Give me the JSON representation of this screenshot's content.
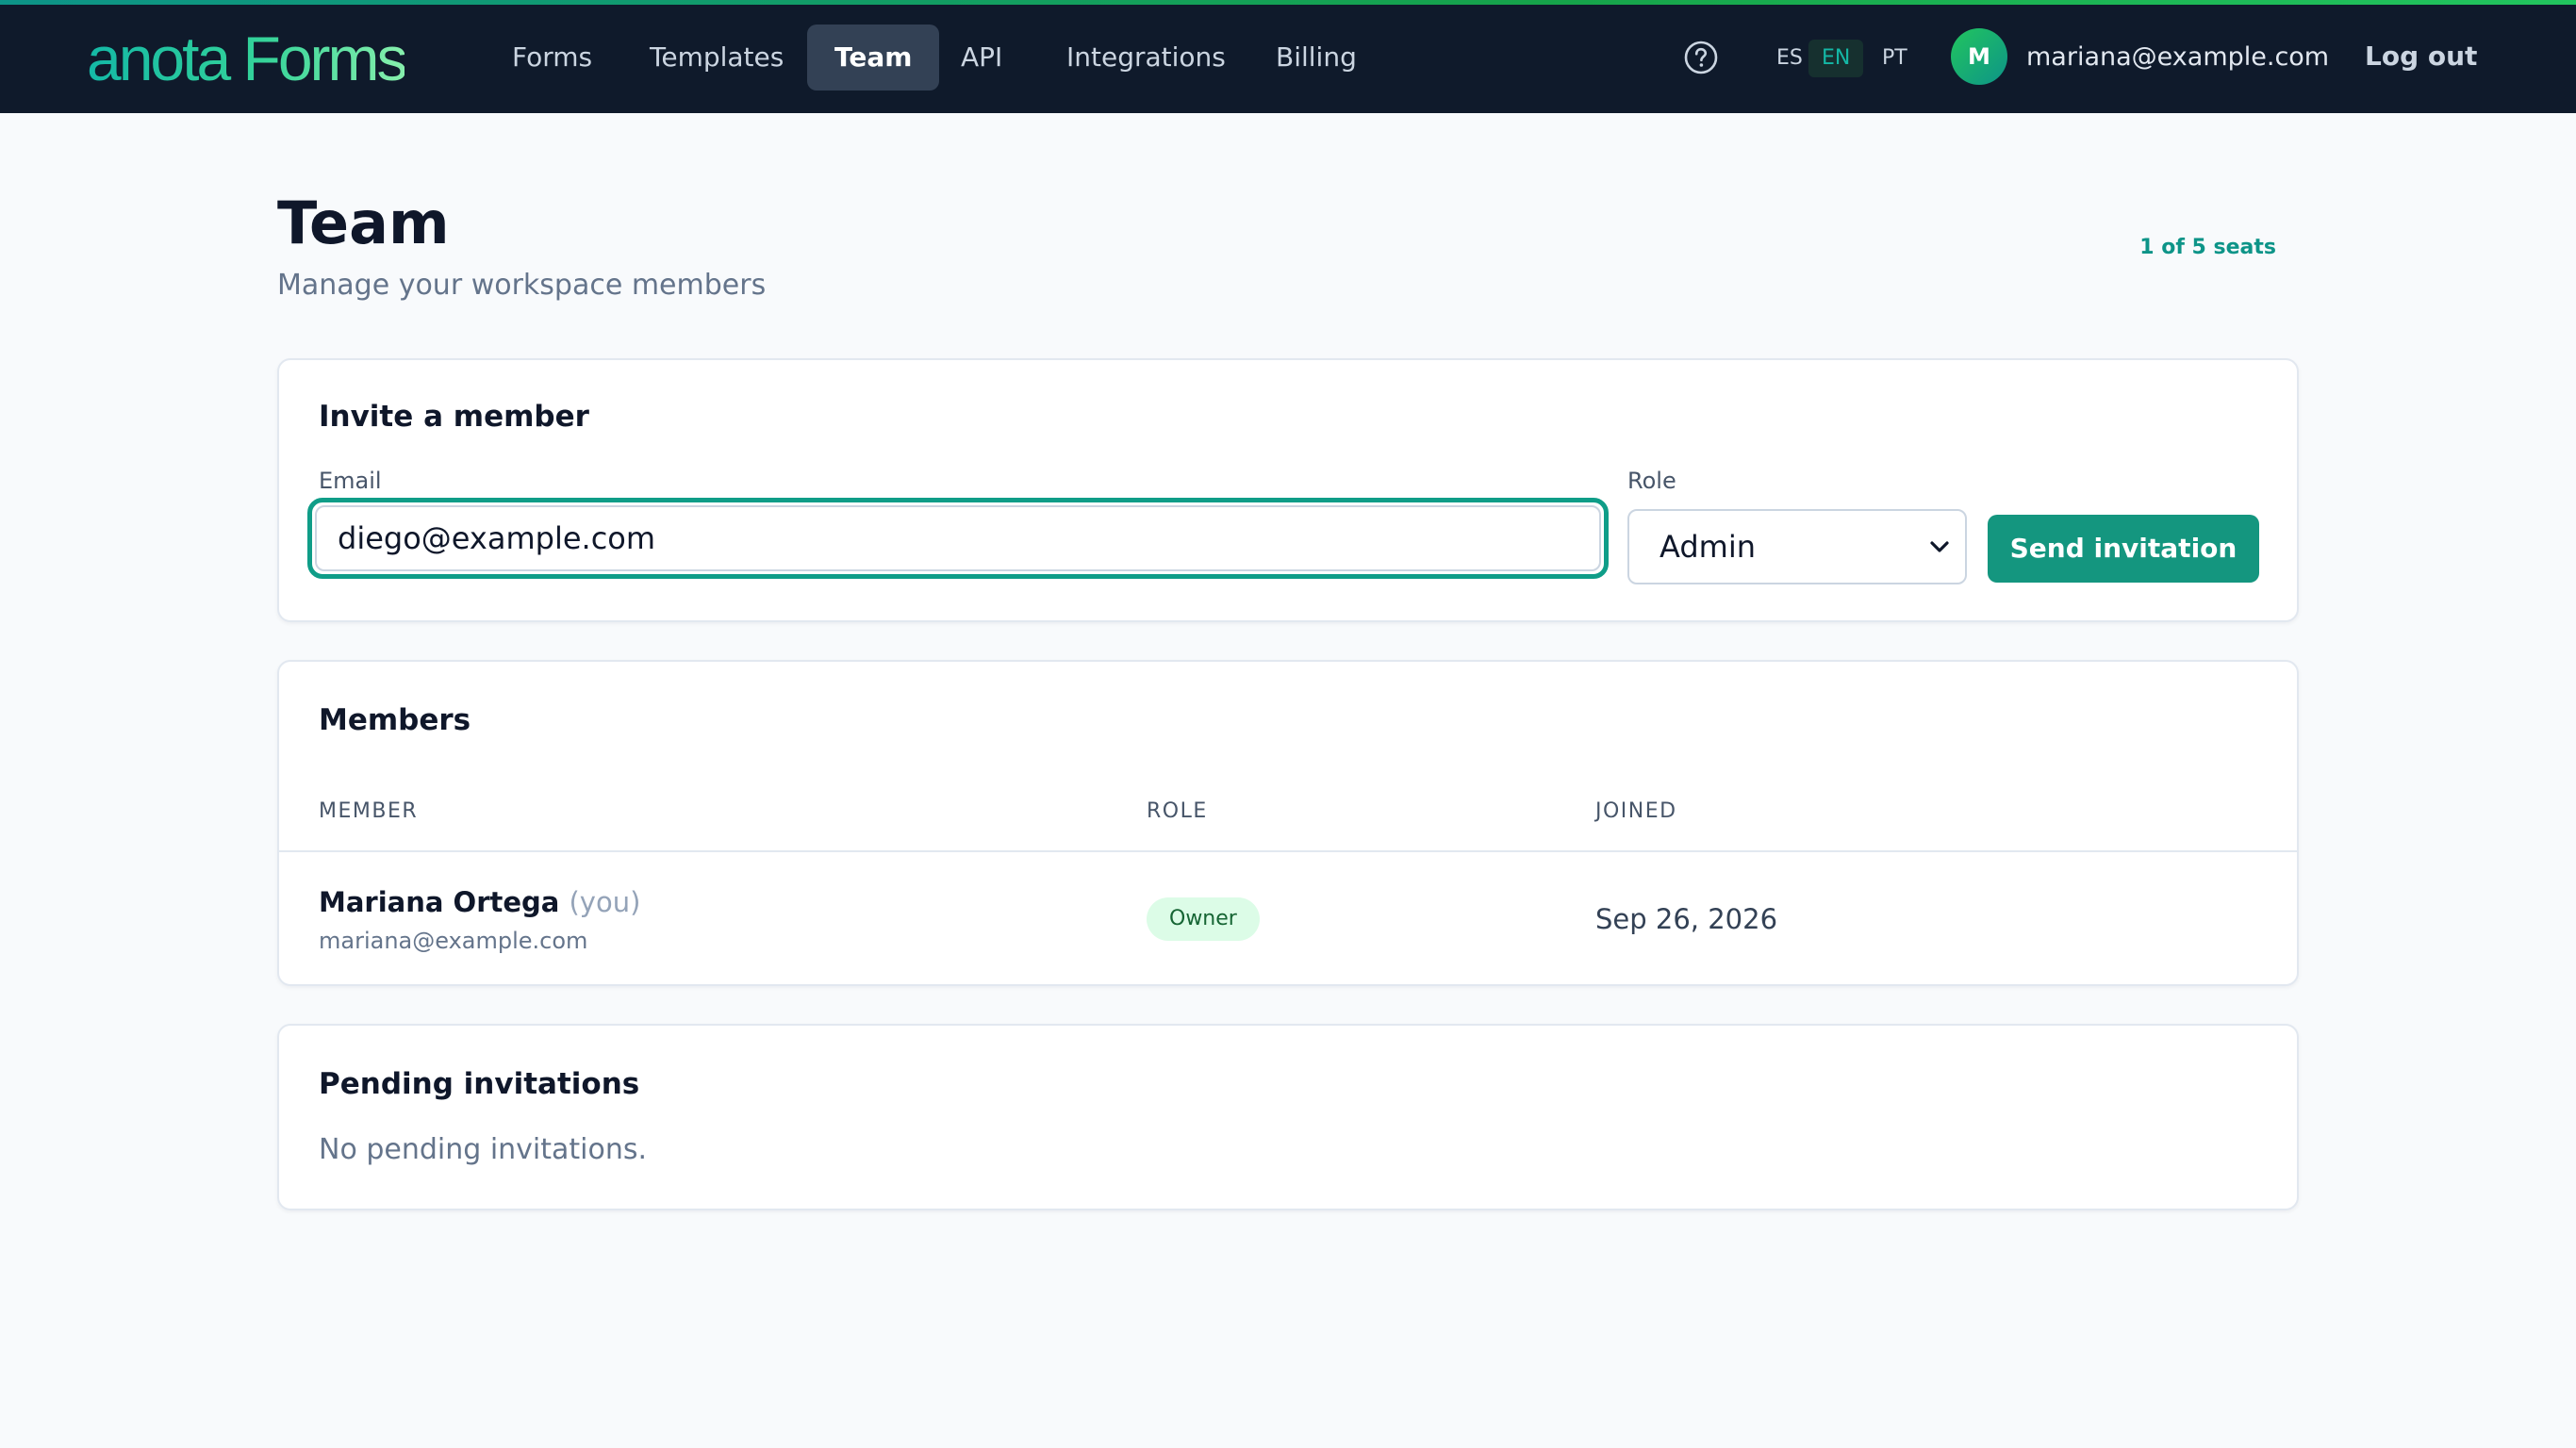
{
  "brand": {
    "logo_text": "anota Forms"
  },
  "nav": {
    "items": [
      {
        "label": "Forms"
      },
      {
        "label": "Templates"
      },
      {
        "label": "Team"
      },
      {
        "label": "API"
      },
      {
        "label": "Integrations"
      },
      {
        "label": "Billing"
      }
    ],
    "active": "Team"
  },
  "header_right": {
    "help_icon": "question-circle-icon",
    "languages": [
      "ES",
      "EN",
      "PT"
    ],
    "active_language": "EN",
    "avatar_initial": "M",
    "user_email": "mariana@example.com",
    "logout_label": "Log out"
  },
  "page": {
    "title": "Team",
    "subtitle": "Manage your workspace members",
    "seats": "1 of 5 seats"
  },
  "invite": {
    "title": "Invite a member",
    "email_label": "Email",
    "email_value": "diego@example.com",
    "role_label": "Role",
    "role_value": "Admin",
    "send_label": "Send invitation"
  },
  "members": {
    "title": "Members",
    "columns": [
      "MEMBER",
      "ROLE",
      "JOINED"
    ],
    "rows": [
      {
        "name": "Mariana Ortega",
        "you_tag": "(you)",
        "email": "mariana@example.com",
        "role": "Owner",
        "joined": "Sep 26, 2026"
      }
    ]
  },
  "pending": {
    "title": "Pending invitations",
    "empty_text": "No pending invitations."
  },
  "colors": {
    "topbar": "#0f1a2b",
    "accent": "#14967f",
    "badge_bg": "#dcfce7",
    "badge_text": "#166534"
  }
}
